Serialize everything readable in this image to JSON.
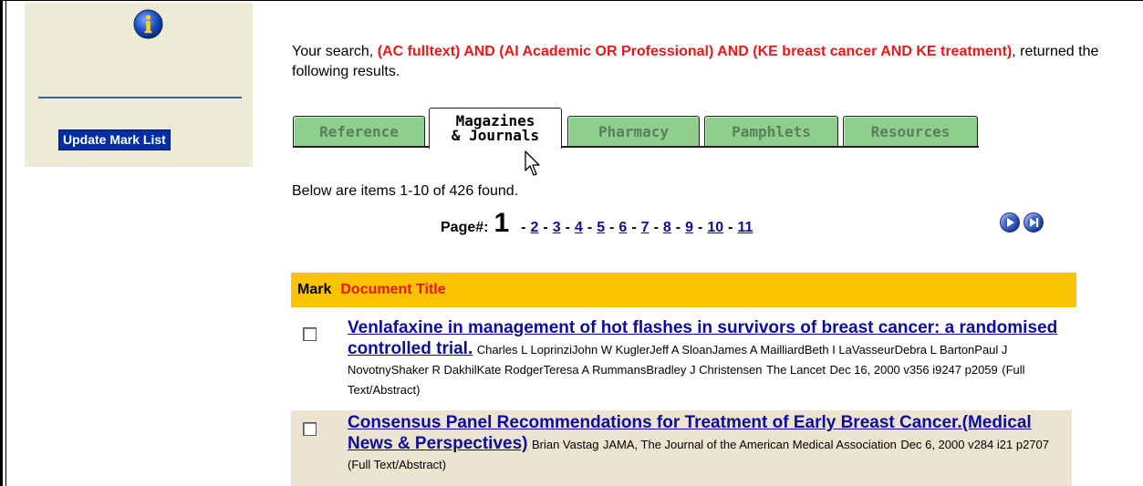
{
  "sidebar": {
    "update_mark_list": "Update Mark List"
  },
  "search": {
    "prefix": "Your search, ",
    "query": "(AC fulltext) AND (AI Academic OR Professional) AND (KE breast cancer AND KE treatment)",
    "suffix": ", returned the following results."
  },
  "tabs": [
    {
      "label": "Reference"
    },
    {
      "label_line1": "Magazines",
      "label_line2": "& Journals",
      "active": true
    },
    {
      "label": "Pharmacy"
    },
    {
      "label": "Pamphlets"
    },
    {
      "label": "Resources"
    }
  ],
  "results": {
    "summary": "Below are items 1-10 of 426 found.",
    "page_label": "Page#:",
    "current_page": "1",
    "pages": [
      "2",
      "3",
      "4",
      "5",
      "6",
      "7",
      "8",
      "9",
      "10",
      "11"
    ]
  },
  "table": {
    "col_mark": "Mark",
    "col_title": "Document Title",
    "rows": [
      {
        "title": "Venlafaxine in management of hot flashes in survivors of breast cancer: a randomised controlled trial.",
        "authors": "Charles L LoprinziJohn W KuglerJeff A SloanJames A MailliardBeth I LaVasseurDebra L BartonPaul J NovotnyShaker R DakhilKate RodgerTeresa A RummansBradley J Christensen",
        "publication": "The Lancet",
        "details": "Dec 16, 2000 v356 i9247 p2059",
        "format": "(Full Text/Abstract)"
      },
      {
        "title": "Consensus Panel Recommendations for Treatment of Early Breast Cancer.(Medical News & Perspectives)",
        "authors": "Brian Vastag",
        "publication": "JAMA, The Journal of the American Medical Association",
        "details": "Dec 6, 2000 v284 i21 p2707",
        "format": "(Full Text/Abstract)"
      }
    ]
  },
  "colors": {
    "sidebar_bg": "#ecebd6",
    "query_highlight": "#e61919",
    "tab_inactive": "#8ecf8e",
    "table_header": "#f9c300",
    "link": "#0d0d9a",
    "button_bg": "#002ea3"
  },
  "icons": {
    "info": "info-icon",
    "next": "next-page-icon",
    "last": "last-page-icon",
    "cursor": "mouse-pointer-icon"
  }
}
